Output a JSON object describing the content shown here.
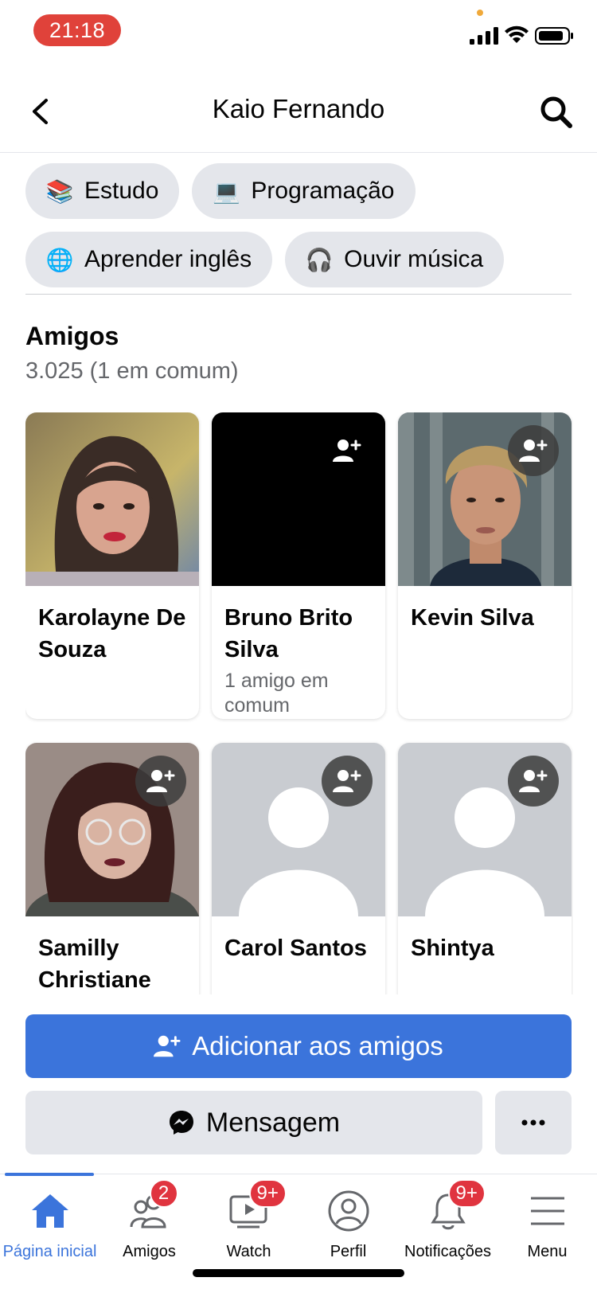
{
  "status_bar": {
    "time": "21:18"
  },
  "header": {
    "title": "Kaio Fernando"
  },
  "hobbies": [
    {
      "emoji": "📚",
      "label": "Estudo"
    },
    {
      "emoji": "💻",
      "label": "Programação"
    },
    {
      "emoji": "🌐",
      "label": "Aprender inglês"
    },
    {
      "emoji": "🎧",
      "label": "Ouvir música"
    }
  ],
  "friends": {
    "title": "Amigos",
    "count": "3.025 (1 em comum)",
    "items": [
      {
        "name": "Karolayne De Souza",
        "mutual": "",
        "photo": "photo-woman-long-hair"
      },
      {
        "name": "Bruno Brito Silva",
        "mutual": "1 amigo em comum",
        "photo": "black"
      },
      {
        "name": "Kevin Silva",
        "mutual": "",
        "photo": "photo-man-curly-hair"
      },
      {
        "name": "Samilly Christiane",
        "mutual": "",
        "photo": "photo-woman-glasses"
      },
      {
        "name": "Carol Santos",
        "mutual": "",
        "photo": "default-avatar"
      },
      {
        "name": "Shintya",
        "mutual": "",
        "photo": "default-avatar"
      }
    ]
  },
  "actions": {
    "add_friend_label": "Adicionar aos amigos",
    "message_label": "Mensagem",
    "more_icon": "ellipsis-icon"
  },
  "tabs": [
    {
      "label": "Página inicial",
      "icon": "home-icon",
      "badge": "",
      "active": true
    },
    {
      "label": "Amigos",
      "icon": "friends-icon",
      "badge": "2",
      "active": false
    },
    {
      "label": "Watch",
      "icon": "watch-icon",
      "badge": "9+",
      "active": false
    },
    {
      "label": "Perfil",
      "icon": "profile-icon",
      "badge": "",
      "active": false
    },
    {
      "label": "Notificações",
      "icon": "bell-icon",
      "badge": "9+",
      "active": false
    },
    {
      "label": "Menu",
      "icon": "menu-icon",
      "badge": "",
      "active": false
    }
  ],
  "colors": {
    "accent": "#3b74db",
    "chip_bg": "#e4e6eb",
    "badge": "#e0343f",
    "time_pill": "#e0423a"
  }
}
